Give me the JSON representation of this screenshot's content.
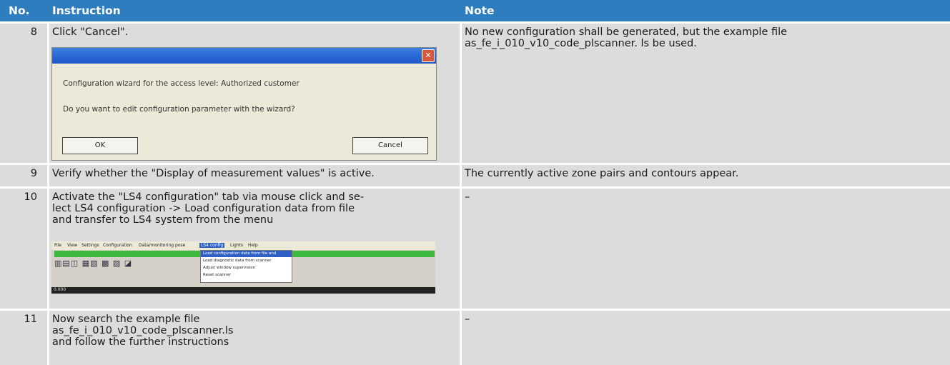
{
  "header": {
    "no": "No.",
    "instruction": "Instruction",
    "note": "Note"
  },
  "rows": [
    {
      "no": "8",
      "instruction": "Click \"Cancel\".",
      "note": "No new configuration shall be generated, but the example file\nas_fe_i_010_v10_code_plscanner. ls be used."
    },
    {
      "no": "9",
      "instruction": "Verify whether the \"Display of measurement values\" is active.",
      "note": "The currently active zone pairs and contours appear."
    },
    {
      "no": "10",
      "instruction": "Activate the \"LS4 configuration\" tab via mouse click and se-\nlect LS4 configuration -> Load configuration data from file\nand transfer to LS4 system from the menu",
      "note": "–"
    },
    {
      "no": "11",
      "instruction": "Now search the example file\nas_fe_i_010_v10_code_plscanner.ls\nand follow the further instructions",
      "note": "–"
    }
  ],
  "dialog": {
    "message1": "Configuration wizard for the access level: Authorized customer",
    "message2": "Do you want to edit configuration parameter with the wizard?",
    "ok_label": "OK",
    "cancel_label": "Cancel",
    "close_glyph": "✕"
  },
  "menu_shot": {
    "menubar": [
      "File",
      "View",
      "Settings",
      "Configuration",
      "Data/monitoring pose",
      "LS4 config",
      "Lights",
      "Help"
    ],
    "dropdown": [
      "Load configuration data from file and transfer",
      "Load diagnostic data from scanner",
      "Adjust window supervision",
      "Reset scanner"
    ],
    "status": "0.000"
  },
  "colors": {
    "header_bg": "#2e7dbf",
    "cell_bg": "#dcdcdc",
    "accent_green": "#3cb83c"
  }
}
